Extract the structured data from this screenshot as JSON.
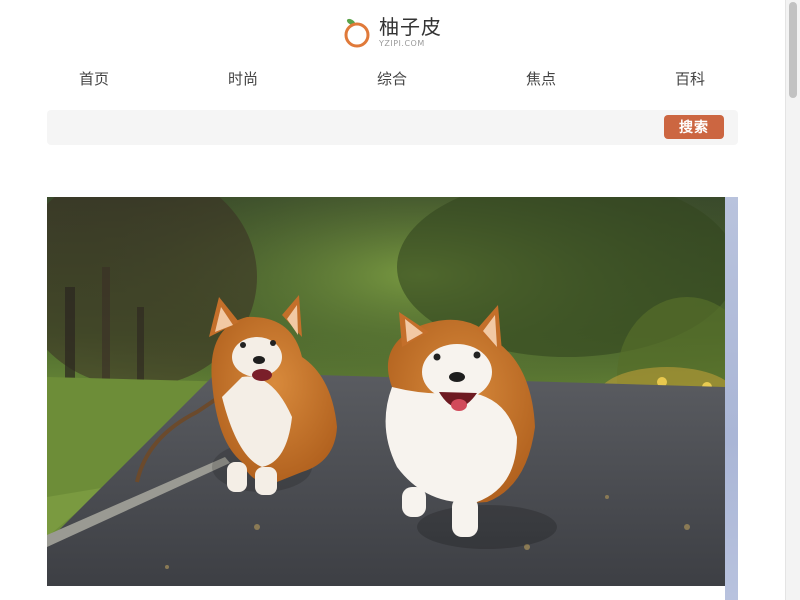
{
  "header": {
    "logo_title": "柚子皮",
    "logo_subtitle": "YZIPI.COM",
    "logo_icon": "citrus-icon"
  },
  "nav": {
    "items": [
      {
        "label": "首页"
      },
      {
        "label": "时尚"
      },
      {
        "label": "综合"
      },
      {
        "label": "焦点"
      },
      {
        "label": "百科"
      }
    ]
  },
  "search": {
    "placeholder": "",
    "value": "",
    "button_label": "搜索"
  },
  "banner": {
    "subject": "two-corgis-running-photo"
  },
  "colors": {
    "accent": "#cc6641",
    "logo_orange": "#e07a3a",
    "logo_leaf": "#5aa34a",
    "search_bg": "#f5f5f5",
    "text": "#444444"
  }
}
